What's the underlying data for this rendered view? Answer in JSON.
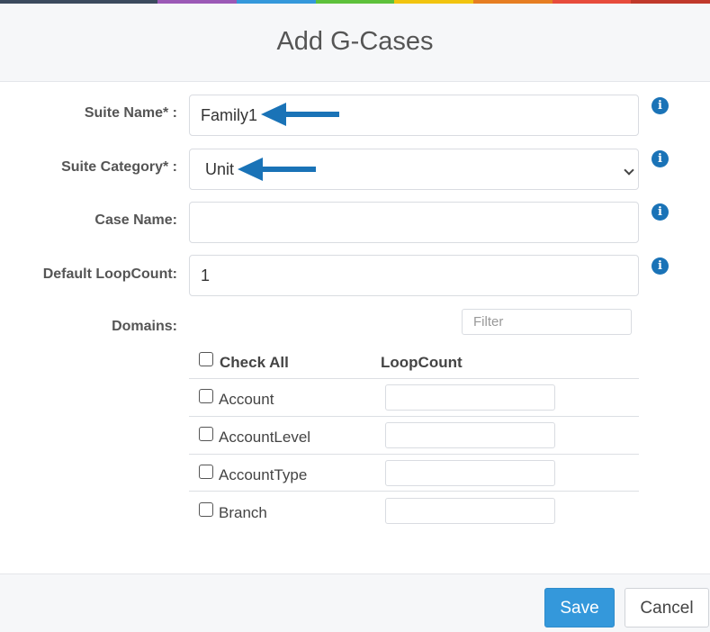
{
  "colors": {
    "rainbow": [
      "#3b4a5e",
      "#3b4a5e",
      "#9b59b6",
      "#3498db",
      "#5ec13b",
      "#f1c40f",
      "#e67e22",
      "#e74c3c",
      "#c0392b"
    ],
    "accent": "#3498db",
    "info_icon": "#1a73b7",
    "arrow": "#1a73b7"
  },
  "header": {
    "title": "Add G-Cases"
  },
  "form": {
    "suite_name": {
      "label": "Suite Name* :",
      "value": "Family1"
    },
    "suite_category": {
      "label": "Suite Category* :",
      "value": "Unit"
    },
    "case_name": {
      "label": "Case Name:",
      "value": ""
    },
    "default_loopcount": {
      "label": "Default LoopCount:",
      "value": "1"
    },
    "domains": {
      "label": "Domains:",
      "filter_placeholder": "Filter",
      "check_all_label": "Check All",
      "loopcount_header": "LoopCount",
      "items": [
        {
          "name": "Account",
          "loopcount": ""
        },
        {
          "name": "AccountLevel",
          "loopcount": ""
        },
        {
          "name": "AccountType",
          "loopcount": ""
        },
        {
          "name": "Branch",
          "loopcount": ""
        }
      ]
    }
  },
  "icons": {
    "info": "info-icon",
    "arrow": "arrow-left-icon",
    "chevron": "chevron-down-icon"
  },
  "footer": {
    "save_label": "Save",
    "cancel_label": "Cancel"
  }
}
